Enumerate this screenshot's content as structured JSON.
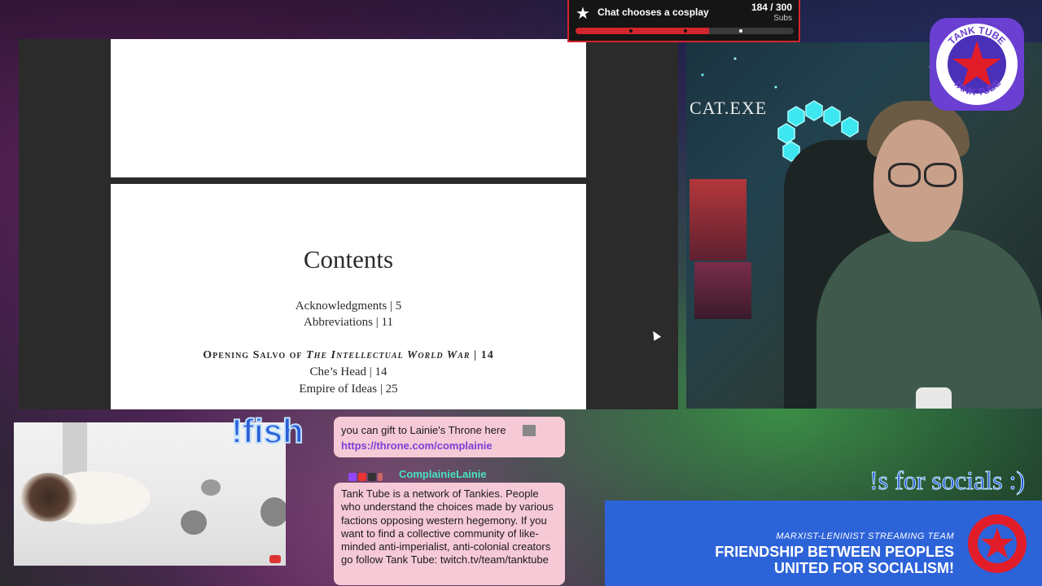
{
  "goal": {
    "title": "Chat chooses a cosplay",
    "count": "184 / 300",
    "unit": "Subs",
    "progress": 0.613,
    "accent": "#d3252c"
  },
  "document": {
    "heading": "Contents",
    "entries": [
      {
        "text": "Acknowledgments  |  5"
      },
      {
        "text": "Abbreviations  |  11"
      },
      {
        "text": "Che’s Head | 14"
      },
      {
        "text": "Empire of Ideas | 25"
      }
    ],
    "section": {
      "prefix": "Opening Salvo of ",
      "title": "The Intellectual World War",
      "suffix": " | 14"
    }
  },
  "webcam": {
    "wall_sign": "CAT.EXE"
  },
  "logo": {
    "text_top": "TANK TUBE",
    "text_bottom": "TANK TUBE",
    "icon": "red-star-icon"
  },
  "overlay": {
    "fish_command": "!fish",
    "socials": "!s for socials :)"
  },
  "chat": {
    "messages": [
      {
        "text": "you can gift to Lainie's Throne here",
        "link": "https://throne.com/complainie",
        "emote": "cat-emote"
      },
      {
        "username": "ComplainieLainie",
        "username_color": "#48e3c0",
        "text": "Tank Tube is a network of Tankies. People who understand the choices made by various factions opposing western hegemony. If you want to find a collective community of like-minded anti-imperialist, anti-colonial creators go follow Tank Tube: twitch.tv/team/tanktube"
      }
    ]
  },
  "banner": {
    "subtitle": "MARXIST-LENINIST STREAMING TEAM",
    "line1": "FRIENDSHIP BETWEEN PEOPLES",
    "line2": "UNITED FOR SOCIALISM!",
    "color": "#2d63d9"
  }
}
